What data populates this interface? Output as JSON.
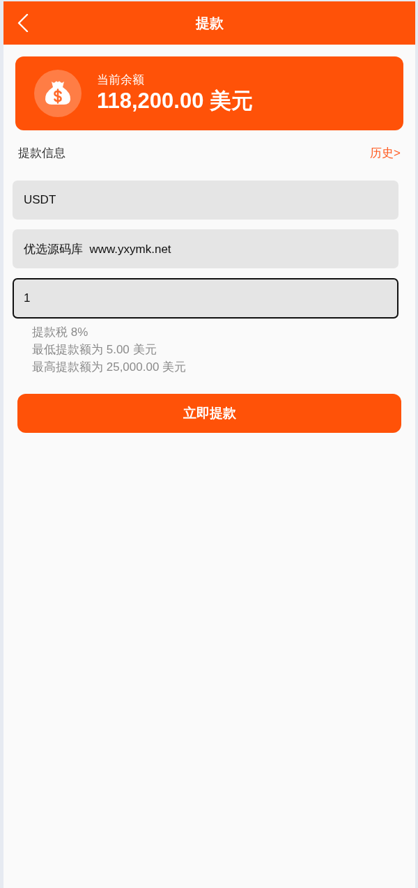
{
  "header": {
    "title": "提款"
  },
  "balance": {
    "label": "当前余额",
    "amount": "118,200.00 美元"
  },
  "section": {
    "title": "提款信息",
    "history_link": "历史>"
  },
  "fields": [
    {
      "value": "USDT",
      "focused": false
    },
    {
      "value": "优选源码库  www.yxymk.net",
      "focused": false
    },
    {
      "value": "1",
      "focused": true
    }
  ],
  "notes": [
    "提款税 8%",
    "最低提款额为 5.00 美元",
    "最高提款额为 25,000.00 美元"
  ],
  "submit_button": "立即提款"
}
